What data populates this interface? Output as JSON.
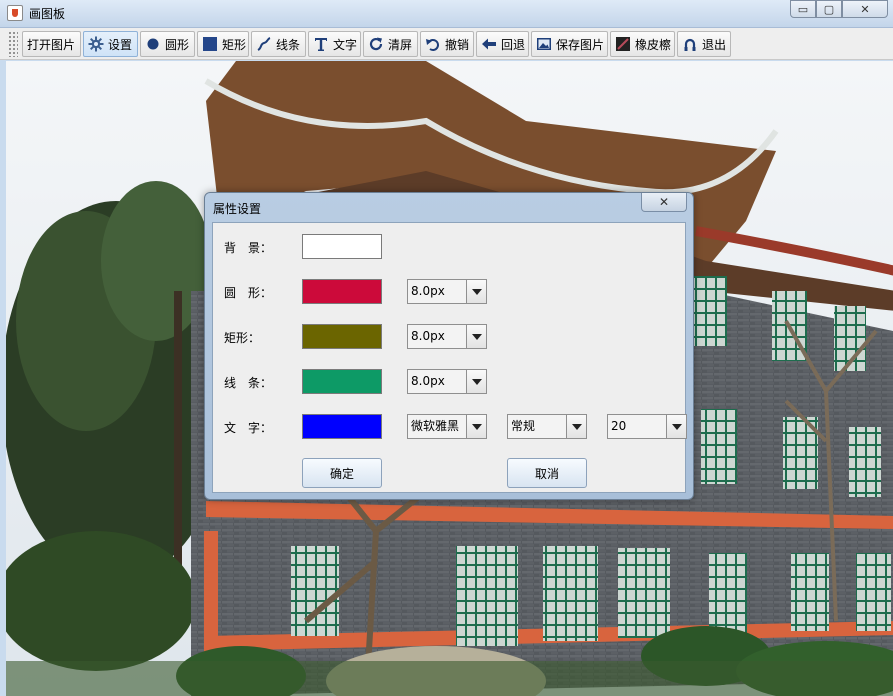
{
  "window": {
    "title": "画图板",
    "buttons": {
      "minimize": "▭",
      "maximize": "▢",
      "close": "✕"
    }
  },
  "toolbar": {
    "items": [
      {
        "label": "打开图片",
        "icon": "none"
      },
      {
        "label": "设置",
        "icon": "gear-icon",
        "active": true
      },
      {
        "label": "圆形",
        "icon": "circle-icon"
      },
      {
        "label": "矩形",
        "icon": "rectangle-icon"
      },
      {
        "label": "线条",
        "icon": "line-icon"
      },
      {
        "label": "文字",
        "icon": "text-icon"
      },
      {
        "label": "清屏",
        "icon": "refresh-icon"
      },
      {
        "label": "撤销",
        "icon": "undo-icon"
      },
      {
        "label": "回退",
        "icon": "back-arrow-icon"
      },
      {
        "label": "保存图片",
        "icon": "image-icon"
      },
      {
        "label": "橡皮檫",
        "icon": "eraser-icon"
      },
      {
        "label": "退出",
        "icon": "exit-icon"
      }
    ]
  },
  "dialog": {
    "title": "属性设置",
    "close_label": "✕",
    "rows": {
      "background": {
        "label": "背　景：",
        "color": "#ffffff"
      },
      "circle": {
        "label": "圆　形：",
        "color": "#cc0a3a",
        "size": "8.0px"
      },
      "rect": {
        "label": "矩形：",
        "color": "#6b6500",
        "size": "8.0px"
      },
      "line": {
        "label": "线　条：",
        "color": "#0d9a66",
        "size": "8.0px"
      },
      "text": {
        "label": "文　字：",
        "color": "#0000ff",
        "font": "微软雅黑",
        "style": "常规",
        "size": "20"
      }
    },
    "ok_label": "确定",
    "cancel_label": "取消"
  }
}
